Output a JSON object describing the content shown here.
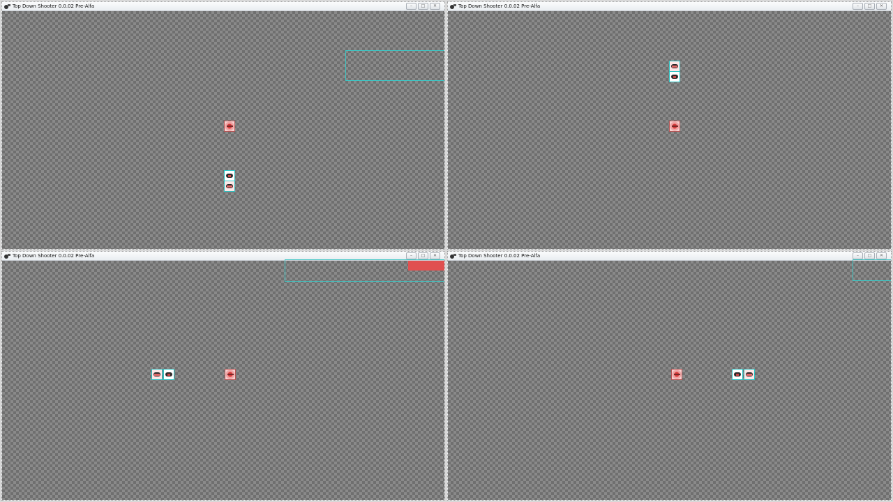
{
  "windows": [
    {
      "title": "Top Down Shooter 0.0.02 Pre-Alfa"
    },
    {
      "title": "Top Down Shooter 0.0.02 Pre-Alfa"
    },
    {
      "title": "Top Down Shooter 0.0.02 Pre-Alfa"
    },
    {
      "title": "Top Down Shooter 0.0.02 Pre-Alfa"
    }
  ],
  "caption_buttons": {
    "minimize": "–",
    "maximize": "□",
    "close": "✕"
  },
  "colors": {
    "canvas_dark": "#6f6f6f",
    "canvas_light": "#8a8a8a",
    "selection": "#3ec6c4",
    "health": "#e05050"
  },
  "icons": [
    "app-icon",
    "minimize-icon",
    "maximize-icon",
    "close-icon"
  ]
}
